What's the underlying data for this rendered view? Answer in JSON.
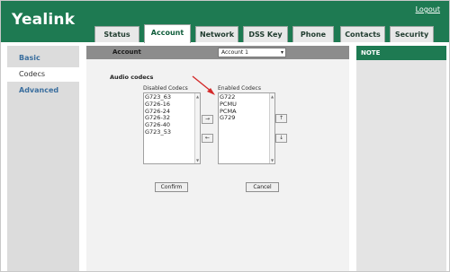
{
  "brand": {
    "logo": "Yealink"
  },
  "header": {
    "logout": "Logout",
    "tabs": [
      {
        "label": "Status"
      },
      {
        "label": "Account"
      },
      {
        "label": "Network"
      },
      {
        "label": "DSS Key"
      },
      {
        "label": "Phone"
      },
      {
        "label": "Contacts"
      },
      {
        "label": "Security"
      }
    ],
    "active_tab": "Account"
  },
  "sidebar": {
    "items": [
      {
        "label": "Basic"
      },
      {
        "label": "Codecs"
      },
      {
        "label": "Advanced"
      }
    ],
    "active_item": "Codecs"
  },
  "main": {
    "titlebar_label": "Account",
    "account_select": "Account 1",
    "section_title": "Audio codecs",
    "disabled": {
      "label": "Disabled Codecs",
      "items": [
        "G723_63",
        "G726-16",
        "G726-24",
        "G726-32",
        "G726-40",
        "G723_53"
      ]
    },
    "enabled": {
      "label": "Enabled Codecs",
      "items": [
        "G722",
        "PCMU",
        "PCMA",
        "G729"
      ]
    },
    "move_right": "→",
    "move_left": "←",
    "move_up": "↑",
    "move_down": "↓",
    "confirm": "Confirm",
    "cancel": "Cancel"
  },
  "note": {
    "title": "NOTE"
  },
  "colors": {
    "header": "#1e7a52",
    "annotation_arrow": "#d42a2a"
  }
}
